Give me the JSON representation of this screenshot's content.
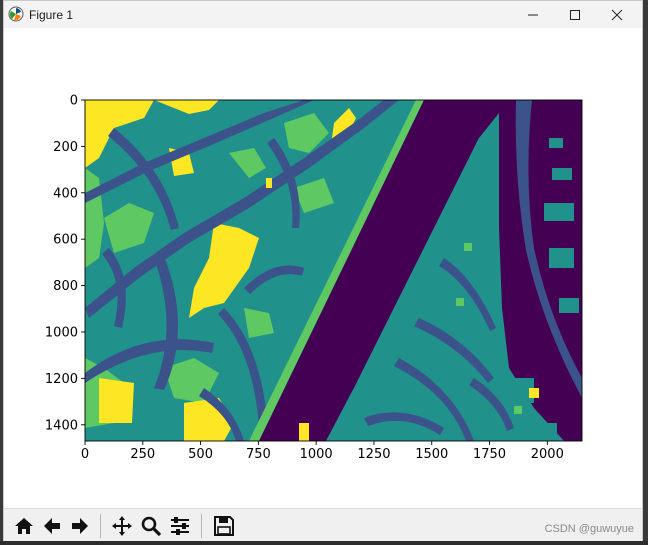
{
  "window": {
    "title": "Figure 1",
    "icon": "matplotlib-icon",
    "controls": [
      "minimize-icon",
      "maximize-icon",
      "close-icon"
    ]
  },
  "toolbar": {
    "buttons": [
      "home-icon",
      "back-icon",
      "forward-icon",
      "pan-icon",
      "zoom-icon",
      "configure-subplots-icon",
      "save-icon"
    ],
    "watermark": "CSDN @guwuyue"
  },
  "chart_data": {
    "type": "heatmap",
    "title": "",
    "xlabel": "",
    "ylabel": "",
    "xlim": [
      0,
      2150
    ],
    "ylim": [
      1470,
      0
    ],
    "x_ticks": [
      "0",
      "250",
      "500",
      "750",
      "1000",
      "1250",
      "1500",
      "1750",
      "2000"
    ],
    "y_ticks": [
      "0",
      "200",
      "400",
      "600",
      "800",
      "1000",
      "1200",
      "1400"
    ],
    "colormap": "viridis",
    "class_colors": {
      "background": "#440154",
      "roads": "#3b528b",
      "buildings": "#21918c",
      "vegetation": "#5ec962",
      "open-land": "#fde725"
    },
    "grid": false
  }
}
